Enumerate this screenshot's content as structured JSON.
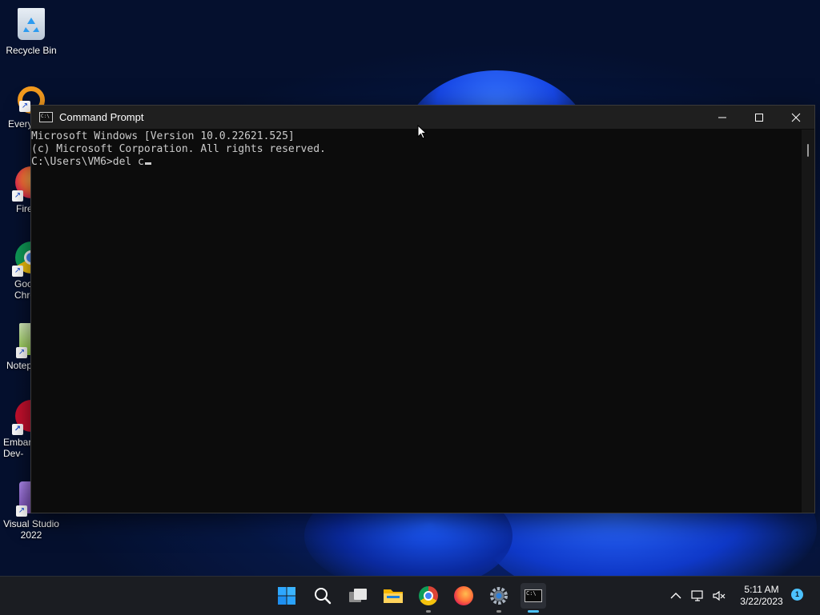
{
  "desktop": {
    "icons": [
      {
        "label": "Recycle Bin"
      },
      {
        "label": "Every"
      },
      {
        "label": "Fire"
      },
      {
        "label": "Goo\nChro"
      },
      {
        "label": "Notep"
      },
      {
        "label": "Embar\nDev-"
      },
      {
        "label": "Visual Studio\n2022"
      }
    ]
  },
  "window": {
    "title": "Command Prompt",
    "lines": [
      "Microsoft Windows [Version 10.0.22621.525]",
      "(c) Microsoft Corporation. All rights reserved.",
      "",
      "C:\\Users\\VM6>del c"
    ]
  },
  "taskbar": {
    "clock_time": "5:11 AM",
    "clock_date": "3/22/2023",
    "notification_count": "1"
  }
}
